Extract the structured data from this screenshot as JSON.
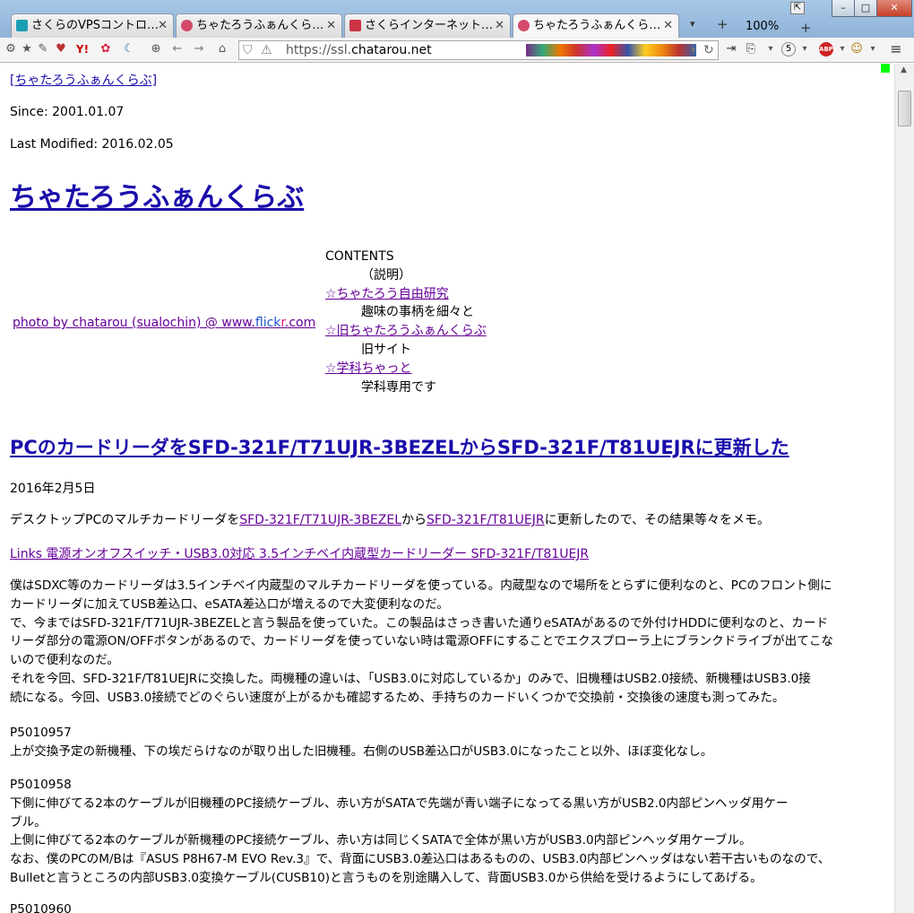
{
  "browser": {
    "tabs": [
      {
        "label": "さくらのVPSコントロ…",
        "color": "#1c9fb5"
      },
      {
        "label": "ちゃたろうふぁんくら…",
        "color": "#d44a6a"
      },
      {
        "label": "さくらインターネット…",
        "color": "#cc3344"
      },
      {
        "label": "ちゃたろうふぁんくら…",
        "color": "#d44a6a"
      }
    ],
    "close_glyph": "✕",
    "new_tab": "+",
    "zoom": "100%",
    "url_prefix": "https://ssl.",
    "url_domain": "chatarou.net",
    "win_min": "–",
    "win_max": "□",
    "win_close": "✕",
    "badge_count": "5",
    "abp": "ABP"
  },
  "page": {
    "top_link": "[ちゃたろうふぁんくらぶ]",
    "since": "Since: 2001.01.07",
    "modified": "Last Modified: 2016.02.05",
    "site_title": "ちゃたろうふぁんくらぶ",
    "photo_credit_a": "photo by chatarou (sualochin) @ www.",
    "photo_credit_b": "flick",
    "photo_credit_c": "r",
    "photo_credit_d": ".com",
    "contents_head": "CONTENTS",
    "contents_desc": "（説明）",
    "menu": [
      {
        "link": "☆ちゃたろう自由研究",
        "desc": "趣味の事柄を細々と"
      },
      {
        "link": "☆旧ちゃたろうふぁんくらぶ",
        "desc": "旧サイト"
      },
      {
        "link": "☆学科ちゃっと",
        "desc": "学科専用です"
      }
    ],
    "article_title": "PCのカードリーダをSFD-321F/T71UJR-3BEZELからSFD-321F/T81UEJRに更新した",
    "date": "2016年2月5日",
    "intro_a": "デスクトップPCのマルチカードリーダを",
    "intro_link1": "SFD-321F/T71UJR-3BEZEL",
    "intro_b": "から",
    "intro_link2": "SFD-321F/T81UEJR",
    "intro_c": "に更新したので、その結果等々をメモ。",
    "product_link": "Links 電源オンオフスイッチ・USB3.0対応 3.5インチベイ内蔵型カードリーダー SFD-321F/T81UEJR",
    "para1": [
      "僕はSDXC等のカードリーダは3.5インチベイ内蔵型のマルチカードリーダを使っている。内蔵型なので場所をとらずに便利なのと、PCのフロント側に",
      "カードリーダに加えてUSB差込口、eSATA差込口が増えるので大変便利なのだ。",
      "で、今まではSFD-321F/T71UJR-3BEZELと言う製品を使っていた。この製品はさっき書いた通りeSATAがあるので外付けHDDに便利なのと、カード",
      "リーダ部分の電源ON/OFFボタンがあるので、カードリーダを使っていない時は電源OFFにすることでエクスプローラ上にブランクドライブが出てこな",
      "いので便利なのだ。",
      "それを今回、SFD-321F/T81UEJRに交換した。両機種の違いは、「USB3.0に対応しているか」のみで、旧機種はUSB2.0接続、新機種はUSB3.0接",
      "続になる。今回、USB3.0接続でどのぐらい速度が上がるかも確認するため、手持ちのカードいくつかで交換前・交換後の速度も測ってみた。"
    ],
    "photo1_id": "P5010957",
    "photo1_caption": "上が交換予定の新機種、下の埃だらけなのが取り出した旧機種。右側のUSB差込口がUSB3.0になったこと以外、ほぼ変化なし。",
    "photo2_id": "P5010958",
    "para2": [
      "下側に伸びてる2本のケーブルが旧機種のPC接続ケーブル、赤い方がSATAで先端が青い端子になってる黒い方がUSB2.0内部ピンヘッダ用ケー",
      "ブル。",
      "上側に伸びてる2本のケーブルが新機種のPC接続ケーブル、赤い方は同じくSATAで全体が黒い方がUSB3.0内部ピンヘッダ用ケーブル。",
      "なお、僕のPCのM/Bは『ASUS P8H67-M EVO Rev.3』で、背面にUSB3.0差込口はあるものの、USB3.0内部ピンヘッダはない若干古いものなので、",
      "Bulletと言うところの内部USB3.0変換ケーブル(CUSB10)と言うものを別途購入して、背面USB3.0から供給を受けるようにしてあげる。"
    ],
    "photo3_id": "P5010960"
  }
}
